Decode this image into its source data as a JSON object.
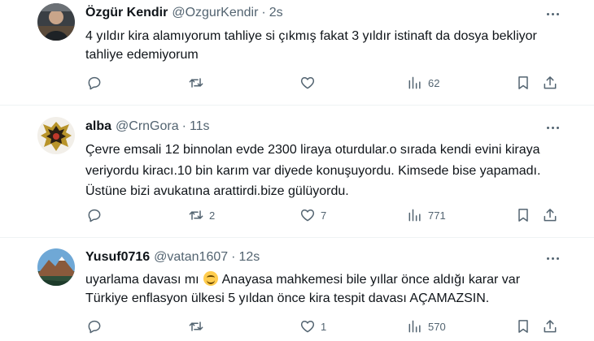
{
  "tweets": [
    {
      "name": "Özgür Kendir",
      "handle": "@OzgurKendir",
      "separator": "·",
      "time": "2s",
      "text": "4 yıldır kira alamıyorum tahliye si çıkmış fakat 3 yıldır istinaft da dosya bekliyor tahliye edemiyorum",
      "replies": "",
      "retweets": "",
      "likes": "",
      "views": "62"
    },
    {
      "name": "alba",
      "handle": "@CrnGora",
      "separator": "·",
      "time": "11s",
      "text": "Çevre emsali 12 binnolan evde 2300 liraya oturdular.o sırada kendi evini kiraya veriyordu kiracı.10 bin karım var diyede konuşuyordu. Kimsede bise yapamadı. Üstüne bizi avukatına arattirdi.bize gülüyordu.",
      "replies": "",
      "retweets": "2",
      "likes": "7",
      "views": "771"
    },
    {
      "name": "Yusuf0716",
      "handle": "@vatan1607",
      "separator": "·",
      "time": "12s",
      "text_before_emoji": "uyarlama davası mı",
      "emoji": "grinning-squinting-face",
      "text_after_emoji": "Anayasa mahkemesi bile yıllar önce aldığı karar var Türkiye enflasyon ülkesi 5 yıldan önce kira tespit davası AÇAMAZSIN.",
      "replies": "",
      "retweets": "",
      "likes": "1",
      "views": "570"
    }
  ],
  "icons": {
    "reply": "reply-icon",
    "retweet": "retweet-icon",
    "like": "heart-icon",
    "views": "views-icon",
    "bookmark": "bookmark-icon",
    "share": "share-icon",
    "more": "more-icon"
  },
  "colors": {
    "text": "#0f1419",
    "secondary": "#536471",
    "divider": "#eff3f4"
  }
}
